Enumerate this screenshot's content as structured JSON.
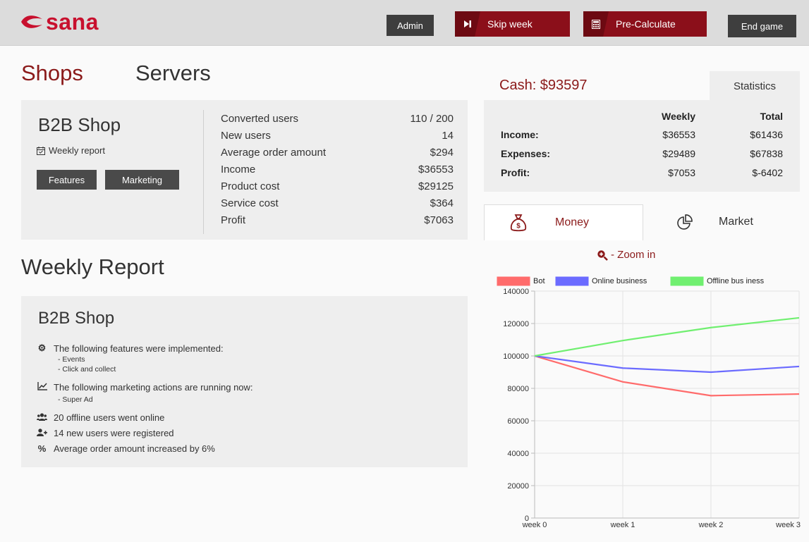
{
  "header": {
    "logo_text": "sana",
    "buttons": {
      "admin": "Admin",
      "skip_week": "Skip week",
      "pre_calculate": "Pre-Calculate",
      "end_game": "End game"
    }
  },
  "tabs": {
    "shops": "Shops",
    "servers": "Servers"
  },
  "shop": {
    "name": "B2B Shop",
    "weekly_report_link": "Weekly report",
    "features_btn": "Features",
    "marketing_btn": "Marketing",
    "stats": [
      {
        "label": "Converted users",
        "value": "110 / 200"
      },
      {
        "label": "New users",
        "value": "14"
      },
      {
        "label": "Average order amount",
        "value": "$294"
      },
      {
        "label": "Income",
        "value": "$36553"
      },
      {
        "label": "Product cost",
        "value": "$29125"
      },
      {
        "label": "Service cost",
        "value": "$364"
      },
      {
        "label": "Profit",
        "value": "$7063"
      }
    ]
  },
  "weekly_report": {
    "heading": "Weekly Report",
    "shop_name": "B2B Shop",
    "features_line": "The following features were implemented:",
    "features": [
      "- Events",
      "- Click and collect"
    ],
    "marketing_line": "The following marketing actions are running now:",
    "marketing": [
      "- Super Ad"
    ],
    "offline_line": "20 offline users went online",
    "new_users_line": "14 new users were registered",
    "avg_line": "Average order amount increased by 6%"
  },
  "finance": {
    "cash": "Cash: $93597",
    "statistics_tab": "Statistics",
    "col_weekly": "Weekly",
    "col_total": "Total",
    "rows": [
      {
        "label": "Income:",
        "weekly": "$36553",
        "total": "$61436"
      },
      {
        "label": "Expenses:",
        "weekly": "$29489",
        "total": "$67838"
      },
      {
        "label": "Profit:",
        "weekly": "$7053",
        "total": "$-6402"
      }
    ]
  },
  "chart_tabs": {
    "money": "Money",
    "market": "Market"
  },
  "zoom_label": "- Zoom in",
  "colors": {
    "brand": "#c8102e",
    "dark_red": "#8b1a1a",
    "bot": "#ff6b6b",
    "online": "#6b6bff",
    "offline": "#70ef70"
  },
  "chart_data": {
    "type": "line",
    "categories": [
      "week 0",
      "week 1",
      "week 2",
      "week 3"
    ],
    "series": [
      {
        "name": "Bot",
        "values": [
          100000,
          84000,
          75500,
          76500
        ],
        "color": "#ff6b6b"
      },
      {
        "name": "Online business",
        "values": [
          100000,
          92500,
          90000,
          93500
        ],
        "color": "#6b6bff"
      },
      {
        "name": "Offline bus iness",
        "values": [
          100000,
          109500,
          117500,
          123500
        ],
        "color": "#70ef70"
      }
    ],
    "ylim": [
      0,
      140000
    ],
    "yticks": [
      0,
      20000,
      40000,
      60000,
      80000,
      100000,
      120000,
      140000
    ],
    "legend": "top",
    "grid": true
  }
}
